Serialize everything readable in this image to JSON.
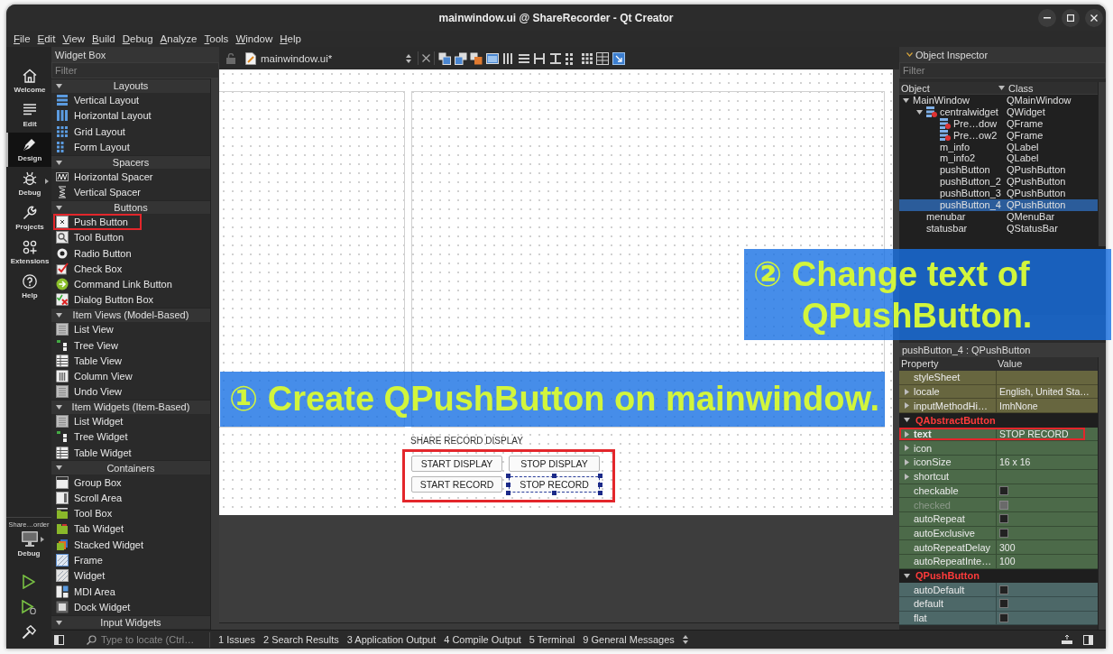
{
  "window": {
    "title": "mainwindow.ui @ ShareRecorder - Qt Creator"
  },
  "menu_bar": [
    "File",
    "Edit",
    "View",
    "Build",
    "Debug",
    "Analyze",
    "Tools",
    "Window",
    "Help"
  ],
  "mode_bar": {
    "modes": [
      {
        "label": "Welcome",
        "selected": false
      },
      {
        "label": "Edit",
        "selected": false
      },
      {
        "label": "Design",
        "selected": true
      },
      {
        "label": "Debug",
        "selected": false
      },
      {
        "label": "Projects",
        "selected": false
      },
      {
        "label": "Extensions",
        "selected": false
      },
      {
        "label": "Help",
        "selected": false
      }
    ],
    "kit": {
      "project": "Share…order",
      "configuration": "Debug"
    }
  },
  "widget_box": {
    "title": "Widget Box",
    "filter": {
      "placeholder": "Filter"
    },
    "categories": [
      {
        "name": "Layouts",
        "expanded": true,
        "items": [
          {
            "label": "Vertical Layout",
            "highlighted": false
          },
          {
            "label": "Horizontal Layout",
            "highlighted": false
          },
          {
            "label": "Grid Layout",
            "highlighted": false
          },
          {
            "label": "Form Layout",
            "highlighted": false
          }
        ]
      },
      {
        "name": "Spacers",
        "expanded": true,
        "items": [
          {
            "label": "Horizontal Spacer",
            "highlighted": false
          },
          {
            "label": "Vertical Spacer",
            "highlighted": false
          }
        ]
      },
      {
        "name": "Buttons",
        "expanded": true,
        "items": [
          {
            "label": "Push Button",
            "highlighted": true
          },
          {
            "label": "Tool Button",
            "highlighted": false
          },
          {
            "label": "Radio Button",
            "highlighted": false
          },
          {
            "label": "Check Box",
            "highlighted": false
          },
          {
            "label": "Command Link Button",
            "highlighted": false
          },
          {
            "label": "Dialog Button Box",
            "highlighted": false
          }
        ]
      },
      {
        "name": "Item Views (Model-Based)",
        "expanded": true,
        "items": [
          {
            "label": "List View",
            "highlighted": false
          },
          {
            "label": "Tree View",
            "highlighted": false
          },
          {
            "label": "Table View",
            "highlighted": false
          },
          {
            "label": "Column View",
            "highlighted": false
          },
          {
            "label": "Undo View",
            "highlighted": false
          }
        ]
      },
      {
        "name": "Item Widgets (Item-Based)",
        "expanded": true,
        "items": [
          {
            "label": "List Widget",
            "highlighted": false
          },
          {
            "label": "Tree Widget",
            "highlighted": false
          },
          {
            "label": "Table Widget",
            "highlighted": false
          }
        ]
      },
      {
        "name": "Containers",
        "expanded": true,
        "items": [
          {
            "label": "Group Box",
            "highlighted": false
          },
          {
            "label": "Scroll Area",
            "highlighted": false
          },
          {
            "label": "Tool Box",
            "highlighted": false
          },
          {
            "label": "Tab Widget",
            "highlighted": false
          },
          {
            "label": "Stacked Widget",
            "highlighted": false
          },
          {
            "label": "Frame",
            "highlighted": false
          },
          {
            "label": "Widget",
            "highlighted": false
          },
          {
            "label": "MDI Area",
            "highlighted": false
          },
          {
            "label": "Dock Widget",
            "highlighted": false
          }
        ]
      },
      {
        "name": "Input Widgets",
        "expanded": true
      }
    ]
  },
  "editor": {
    "document": "mainwindow.ui*",
    "form": {
      "label": "SHARE RECORD DISPLAY",
      "button_group": {
        "highlighted": true,
        "buttons": [
          {
            "label": "START DISPLAY",
            "selected": false
          },
          {
            "label": "STOP DISPLAY",
            "selected": false
          },
          {
            "label": "START RECORD",
            "selected": false
          },
          {
            "label": "STOP RECORD",
            "selected": true
          }
        ]
      }
    }
  },
  "object_inspector": {
    "title": "Object Inspector",
    "filter": {
      "placeholder": "Filter"
    },
    "columns": [
      "Object",
      "Class"
    ],
    "tree": [
      {
        "name": "MainWindow",
        "class": "QMainWindow",
        "selected": false,
        "expanded": true,
        "children": [
          {
            "name": "centralwidget",
            "class": "QWidget",
            "kind": "container",
            "selected": false,
            "expanded": true,
            "children": [
              {
                "name": "Pre…dow",
                "class": "QFrame",
                "kind": "container",
                "selected": false
              },
              {
                "name": "Pre…ow2",
                "class": "QFrame",
                "kind": "container",
                "selected": false
              },
              {
                "name": "m_info",
                "class": "QLabel",
                "selected": false
              },
              {
                "name": "m_info2",
                "class": "QLabel",
                "selected": false
              },
              {
                "name": "pushButton",
                "class": "QPushButton",
                "selected": false
              },
              {
                "name": "pushButton_2",
                "class": "QPushButton",
                "selected": false
              },
              {
                "name": "pushButton_3",
                "class": "QPushButton",
                "selected": false
              },
              {
                "name": "pushButton_4",
                "class": "QPushButton",
                "selected": true
              }
            ]
          },
          {
            "name": "menubar",
            "class": "QMenuBar",
            "selected": false
          },
          {
            "name": "statusbar",
            "class": "QStatusBar",
            "selected": false
          }
        ]
      }
    ]
  },
  "property_editor": {
    "object": "pushButton_4 : QPushButton",
    "columns": [
      "Property",
      "Value"
    ],
    "groups": [
      {
        "color": "#67663f",
        "rows": [
          {
            "name": "styleSheet",
            "kind": "text",
            "modified": false,
            "disabled": false,
            "highlighted": false
          },
          {
            "name": "locale",
            "kind": "text",
            "value": "English, United Sta…",
            "expanded": false,
            "modified": false,
            "disabled": false,
            "highlighted": false
          },
          {
            "name": "inputMethodHi…",
            "kind": "text",
            "value": "ImhNone",
            "expanded": false,
            "modified": false,
            "disabled": false,
            "highlighted": false
          }
        ]
      },
      {
        "name": "QAbstractButton",
        "expanded": true,
        "color": "#4c6a49",
        "rows": [
          {
            "name": "text",
            "kind": "text",
            "value": "STOP RECORD",
            "expanded": false,
            "modified": true,
            "disabled": false,
            "highlighted": true
          },
          {
            "name": "icon",
            "kind": "text",
            "expanded": false,
            "modified": false,
            "disabled": false,
            "highlighted": false
          },
          {
            "name": "iconSize",
            "kind": "text",
            "value": "16 x 16",
            "expanded": false,
            "modified": false,
            "disabled": false,
            "highlighted": false
          },
          {
            "name": "shortcut",
            "kind": "text",
            "expanded": false,
            "modified": false,
            "disabled": false,
            "highlighted": false
          },
          {
            "name": "checkable",
            "kind": "checkbox",
            "checked": false,
            "modified": false,
            "disabled": false,
            "highlighted": false
          },
          {
            "name": "checked",
            "kind": "checkbox",
            "checked": false,
            "modified": false,
            "disabled": true,
            "highlighted": false
          },
          {
            "name": "autoRepeat",
            "kind": "checkbox",
            "checked": false,
            "modified": false,
            "disabled": false,
            "highlighted": false
          },
          {
            "name": "autoExclusive",
            "kind": "checkbox",
            "checked": false,
            "modified": false,
            "disabled": false,
            "highlighted": false
          },
          {
            "name": "autoRepeatDelay",
            "kind": "text",
            "value": "300",
            "modified": false,
            "disabled": false,
            "highlighted": false
          },
          {
            "name": "autoRepeatInte…",
            "kind": "text",
            "value": "100",
            "modified": false,
            "disabled": false,
            "highlighted": false
          }
        ]
      },
      {
        "name": "QPushButton",
        "expanded": true,
        "color": "#4d6868",
        "rows": [
          {
            "name": "autoDefault",
            "kind": "checkbox",
            "checked": false,
            "modified": false,
            "disabled": false,
            "highlighted": false
          },
          {
            "name": "default",
            "kind": "checkbox",
            "checked": false,
            "modified": false,
            "disabled": false,
            "highlighted": false
          },
          {
            "name": "flat",
            "kind": "checkbox",
            "checked": false,
            "modified": false,
            "disabled": false,
            "highlighted": false
          }
        ]
      }
    ]
  },
  "status_bar": {
    "locator": {
      "placeholder": "Type to locate (Ctrl…"
    },
    "panes": [
      "1 Issues",
      "2 Search Results",
      "3 Application Output",
      "4 Compile Output",
      "5 Terminal",
      "9 General Messages"
    ]
  },
  "annotations": [
    {
      "text": "① Create QPushButton on mainwindow."
    },
    {
      "text": "② Change text of QPushButton."
    }
  ]
}
